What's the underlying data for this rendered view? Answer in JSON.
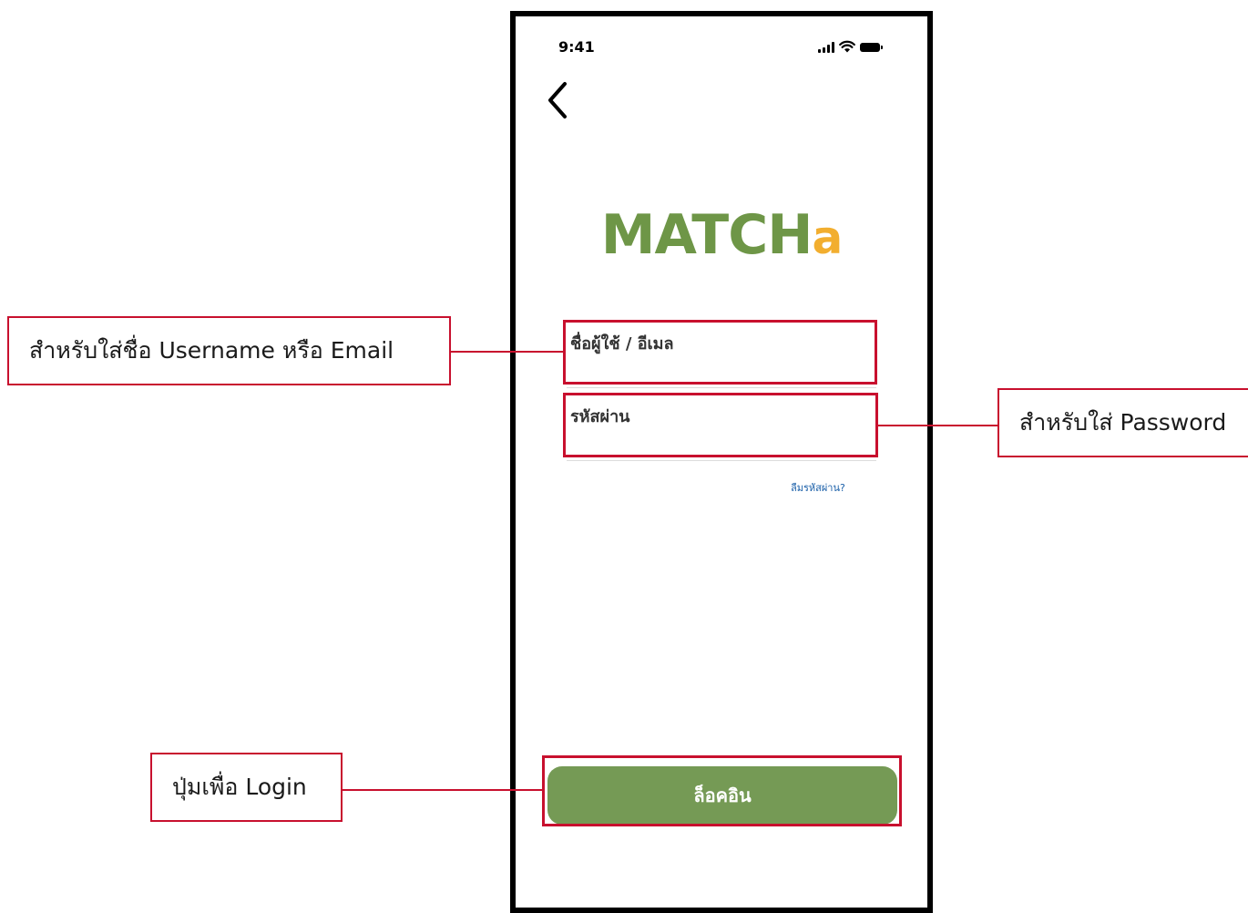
{
  "status_bar": {
    "time": "9:41",
    "signal_icon": "cellular-signal-icon",
    "wifi_icon": "wifi-icon",
    "battery_icon": "battery-icon"
  },
  "nav": {
    "back_icon": "chevron-left-icon"
  },
  "logo": {
    "main_text": "MATCH",
    "accent_text": "a",
    "main_color": "#6e9647",
    "accent_color": "#f2ae2f"
  },
  "login_form": {
    "username_label": "ชื่อผู้ใช้ / อีเมล",
    "username_value": "",
    "password_label": "รหัสผ่าน",
    "password_value": "",
    "forgot_password": "ลืมรหัสผ่าน?",
    "login_button": "ล็อคอิน",
    "button_color": "#759a55"
  },
  "annotations": {
    "username_note": "สำหรับใส่ชื่อ Username หรือ Email",
    "password_note": "สำหรับใส่ Password",
    "login_note": "ปุ่มเพื่อ Login",
    "highlight_color": "#c8102e"
  }
}
